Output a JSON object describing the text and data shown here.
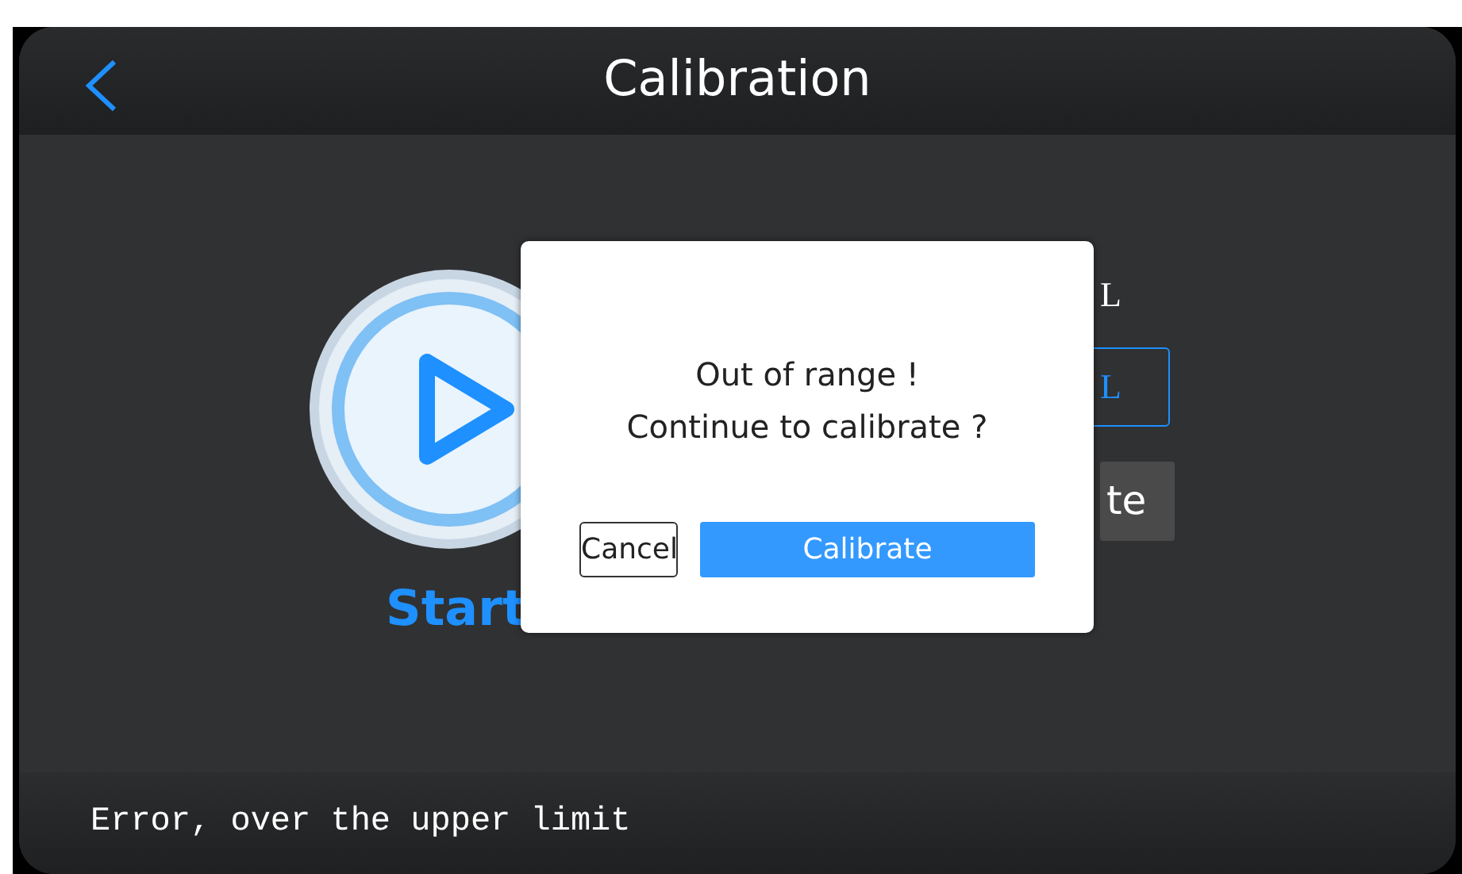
{
  "header": {
    "title": "Calibration"
  },
  "background": {
    "start_label": "Start",
    "unit_label": "L",
    "unit_field": {
      "value": "L"
    },
    "button": "te"
  },
  "dialog": {
    "lines": [
      "Out of range !",
      "Continue to calibrate ?"
    ],
    "buttons": [
      {
        "label": "Cancel",
        "kind": "outline"
      },
      {
        "label": "Calibrate",
        "kind": "primary"
      }
    ]
  },
  "status_bar": {
    "message": "Error, over the upper limit"
  }
}
